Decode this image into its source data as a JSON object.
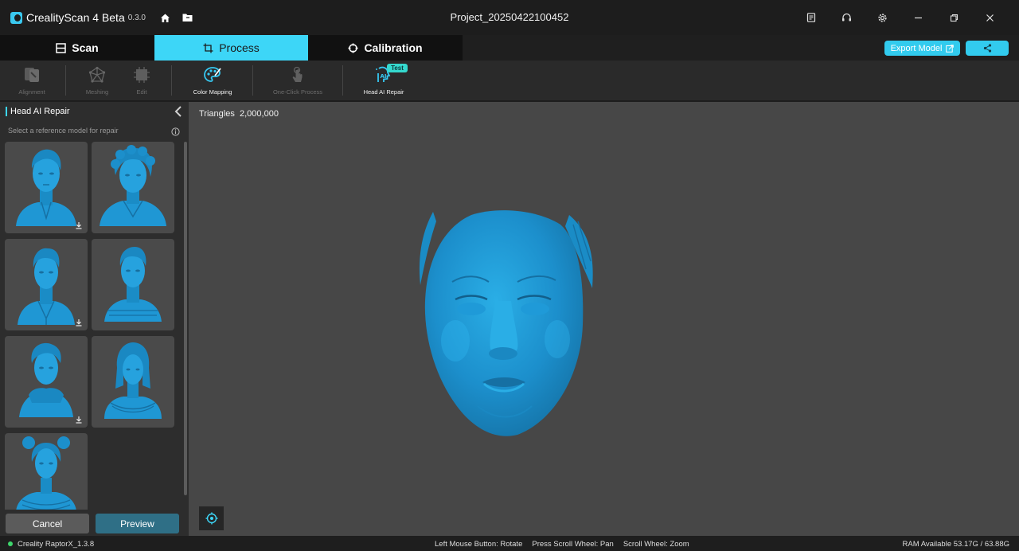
{
  "app": {
    "name": "CrealityScan 4 Beta",
    "version": "0.3.0",
    "project_title": "Project_20250422100452"
  },
  "mode_tabs": [
    {
      "label": "Scan",
      "icon": "scan-frame-icon",
      "active": false
    },
    {
      "label": "Process",
      "icon": "crop-frame-icon",
      "active": true
    },
    {
      "label": "Calibration",
      "icon": "crosshair-icon",
      "active": false
    }
  ],
  "actions": {
    "export_label": "Export Model",
    "share_icon": "share-icon"
  },
  "toolbar": {
    "alignment": "Alignment",
    "meshing": "Meshing",
    "edit": "Edit",
    "color_mapping": "Color Mapping",
    "one_click": "One-Click Process",
    "head_ai_repair": "Head AI Repair",
    "test_badge": "Test"
  },
  "panel": {
    "title": "Head AI Repair",
    "hint": "Select a reference model for repair",
    "models": [
      {
        "kind": "male-bust",
        "download": true
      },
      {
        "kind": "curly-bust",
        "download": false
      },
      {
        "kind": "male-suit-bust",
        "download": true
      },
      {
        "kind": "male-jacket-bust",
        "download": false
      },
      {
        "kind": "male-hoodie-bust",
        "download": true
      },
      {
        "kind": "female-bust",
        "download": false
      },
      {
        "kind": "female-buns-bust",
        "download": false
      }
    ],
    "cancel_label": "Cancel",
    "preview_label": "Preview"
  },
  "viewport": {
    "triangles_label": "Triangles",
    "triangles_value": "2,000,000"
  },
  "status": {
    "plugin": "Creality RaptorX_1.3.8",
    "hint_rotate": "Left Mouse Button: Rotate",
    "hint_pan": "Press Scroll Wheel: Pan",
    "hint_zoom": "Scroll Wheel: Zoom",
    "ram": "RAM Available 53.17G / 63.88G"
  },
  "colors": {
    "accent": "#3dd6f7",
    "model_blue": "#1f97d4",
    "viewport_bg": "#474747"
  }
}
